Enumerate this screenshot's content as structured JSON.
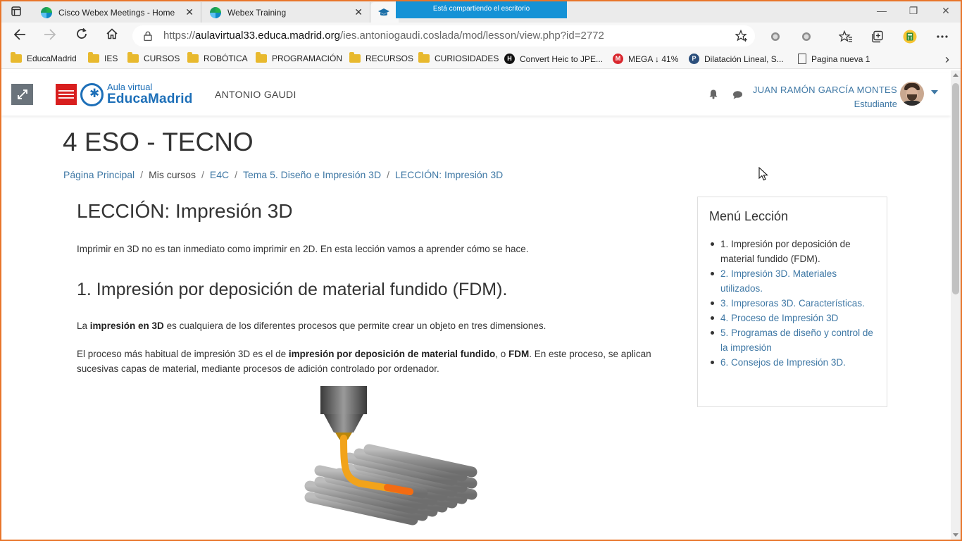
{
  "browser": {
    "tabs": [
      {
        "title": "Cisco Webex Meetings - Home",
        "close": "✕"
      },
      {
        "title": "Webex Training",
        "close": "✕"
      },
      {
        "title": ""
      }
    ],
    "share_banner": "Está compartiendo el escritorio",
    "controls": {
      "minimize": "—",
      "restore": "❐",
      "close": "✕"
    },
    "url_scheme": "https://",
    "url_host": "aulavirtual33.educa.madrid.org",
    "url_path": "/ies.antoniogaudi.coslada/mod/lesson/view.php?id=2772"
  },
  "bookmarks": [
    {
      "label": "EducaMadrid",
      "icon": "folder-icon"
    },
    {
      "label": "IES",
      "icon": "folder-icon"
    },
    {
      "label": "CURSOS",
      "icon": "folder-icon"
    },
    {
      "label": "ROBÓTICA",
      "icon": "folder-icon"
    },
    {
      "label": "PROGRAMACIÓN",
      "icon": "folder-icon"
    },
    {
      "label": "RECURSOS",
      "icon": "folder-icon"
    },
    {
      "label": "CURIOSIDADES",
      "icon": "folder-icon"
    },
    {
      "label": "Convert Heic to JPE...",
      "icon": "h-logo-icon"
    },
    {
      "label": "MEGA ↓ 41%",
      "icon": "mega-logo-icon"
    },
    {
      "label": "Dilatación Lineal, S...",
      "icon": "p-logo-icon"
    },
    {
      "label": "Pagina nueva 1",
      "icon": "page-icon"
    }
  ],
  "header": {
    "logo_small": "Aula virtual",
    "logo_big": "EducaMadrid",
    "site_name": "ANTONIO GAUDI",
    "user_name": "JUAN RAMÓN GARCÍA MONTES",
    "user_role": "Estudiante"
  },
  "page": {
    "course_title": "4 ESO - TECNO",
    "breadcrumb": {
      "home": "Página Principal",
      "my_courses": "Mis cursos",
      "course": "E4C",
      "topic": "Tema 5. Diseño e Impresión 3D",
      "lesson": "LECCIÓN: Impresión 3D",
      "separator": "/"
    },
    "lesson_title": "LECCIÓN: Impresión 3D",
    "intro": "Imprimir en 3D no es tan inmediato como imprimir en 2D. En esta lección vamos a aprender cómo se hace.",
    "section_title": "1. Impresión por deposición de material fundido (FDM).",
    "para1": {
      "a": "La ",
      "b": "impresión en 3D",
      "c": " es cualquiera de los diferentes procesos que permite crear un objeto en tres dimensiones."
    },
    "para2": {
      "a": "El proceso más habitual de impresión 3D es el de ",
      "b": "impresión por deposición de material fundido",
      "c": ", o ",
      "d": "FDM",
      "e": ". En este proceso, se aplican sucesivas capas de material, mediante procesos de adición controlado por ordenador."
    }
  },
  "lesson_menu": {
    "title": "Menú Lección",
    "items": [
      "1. Impresión por deposición de material fundido (FDM).",
      "2. Impresión 3D. Materiales utilizados.",
      "3. Impresoras 3D. Características.",
      "4. Proceso de Impresión 3D",
      "5. Programas de diseño y control de la impresión",
      "6. Consejos de Impresión 3D."
    ]
  },
  "colors": {
    "accent": "#e8752a",
    "link": "#3f78a5",
    "banner": "#1592d6",
    "logo_blue": "#1d6fb8",
    "logo_red": "#d81e1e"
  }
}
